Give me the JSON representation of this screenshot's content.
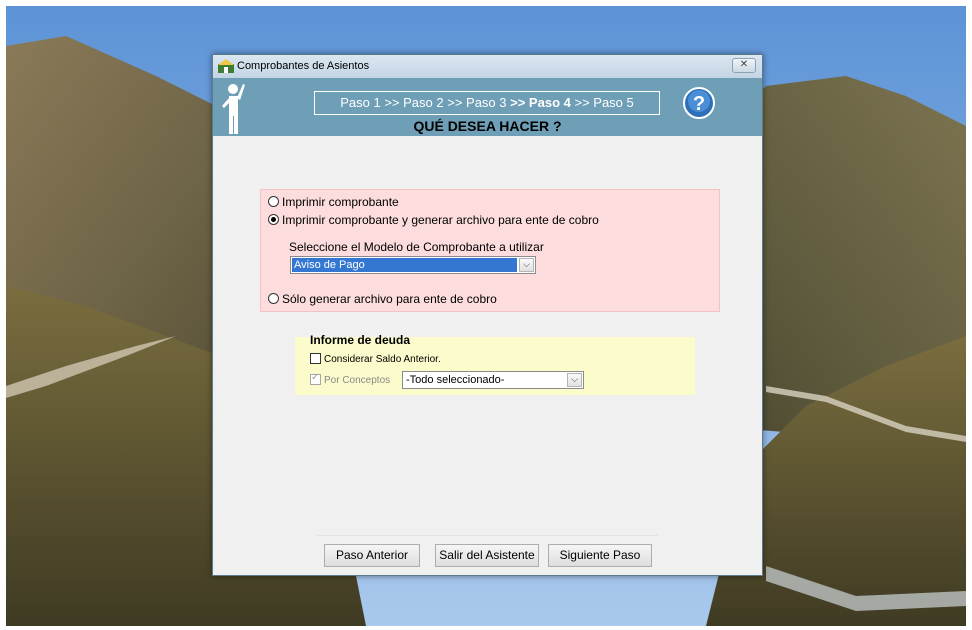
{
  "window": {
    "title": "Comprobantes de Asientos",
    "close_glyph": "✕"
  },
  "header": {
    "steps": {
      "step1": "Paso 1",
      "step2": ">> Paso 2",
      "step3": ">> Paso 3",
      "step4": ">> Paso 4",
      "step5": ">> Paso 5"
    },
    "question": "QUÉ DESEA HACER ?",
    "help_icon": "help-icon"
  },
  "options": {
    "print_only": "Imprimir comprobante",
    "print_and_generate": "Imprimir comprobante y generar archivo para ente de cobro",
    "generate_only": "Sólo generar archivo para ente de cobro",
    "selected": "print_and_generate",
    "model_label": "Seleccione el Modelo de Comprobante a utilizar",
    "model_value": "Aviso de Pago"
  },
  "debt": {
    "title": "Informe de deuda",
    "previous_balance_label": "Considerar Saldo Anterior.",
    "previous_balance_checked": false,
    "by_concepts_label": "Por Conceptos",
    "by_concepts_checked": true,
    "concepts_value": "-Todo seleccionado-"
  },
  "buttons": {
    "back": "Paso Anterior",
    "exit": "Salir del Asistente",
    "next": "Siguiente Paso"
  },
  "colors": {
    "header_bg": "#6f9fb6",
    "options_bg": "#fcdcdc",
    "debt_bg": "#fbfbcc",
    "selection": "#3377d2"
  }
}
